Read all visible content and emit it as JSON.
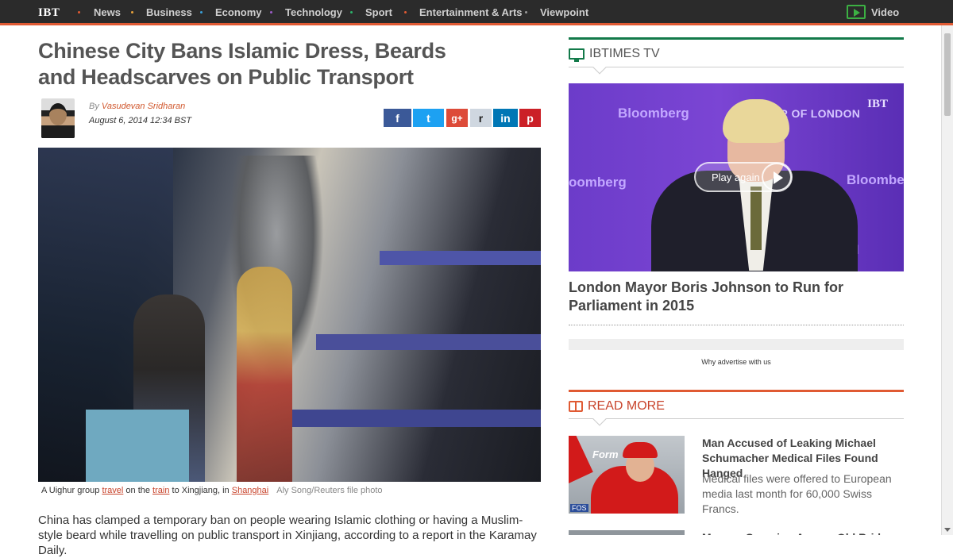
{
  "nav": {
    "logo": "IBT",
    "items": [
      "News",
      "Business",
      "Economy",
      "Technology",
      "Sport",
      "Entertainment & Arts",
      "Viewpoint"
    ],
    "dot_colors": [
      "#e05a33",
      "#e8a23a",
      "#3aa0d8",
      "#9b5cc7",
      "#2db36b",
      "#e05a33",
      "#999999"
    ],
    "video_label": "Video"
  },
  "article": {
    "headline": "Chinese City Bans Islamic Dress, Beards and Headscarves on Public Transport",
    "by": "By",
    "author": "Vasudevan Sridharan",
    "date": "August 6, 2014 12:34 BST",
    "share": {
      "facebook": "f",
      "twitter": "t",
      "google_plus": "g+",
      "reddit": "r",
      "linkedin": "in",
      "pinterest": "p"
    },
    "caption": {
      "t1": "A Uighur group ",
      "l1": "travel",
      "t2": " on the ",
      "l2": "train",
      "t3": " to Xingjiang, in ",
      "l3": "Shanghai",
      "credit": "Aly Song/Reuters file photo"
    },
    "body": "China has clamped a temporary ban on people wearing Islamic clothing or having a Muslim-style beard while travelling on public transport in Xinjiang, according to a report in the Karamay Daily."
  },
  "sidebar": {
    "tv_title": "IBTIMES TV",
    "video_overlay": {
      "bloomberg": "Bloomberg",
      "bloomberg_left": "oomberg",
      "bloomberg_right": "Bloombe",
      "mayor": "MAYOR OF LONDON",
      "ibt": "IBT",
      "play_again": "Play again",
      "lower": "ON"
    },
    "tv_headline": "London Mayor Boris Johnson to Run for Parliament in 2015",
    "advertise": "Why advertise with us",
    "read_more_title": "READ MORE",
    "read_more": {
      "title": "Man Accused of Leaking Michael Schumacher Medical Files Found Hanged",
      "summary": "Medical files were offered to European media last month for 60,000 Swiss Francs.",
      "thumb_banner": "Form",
      "thumb_logo": "FOS",
      "next_title": "Mourne Crossing Across Old Bridge Take"
    }
  }
}
